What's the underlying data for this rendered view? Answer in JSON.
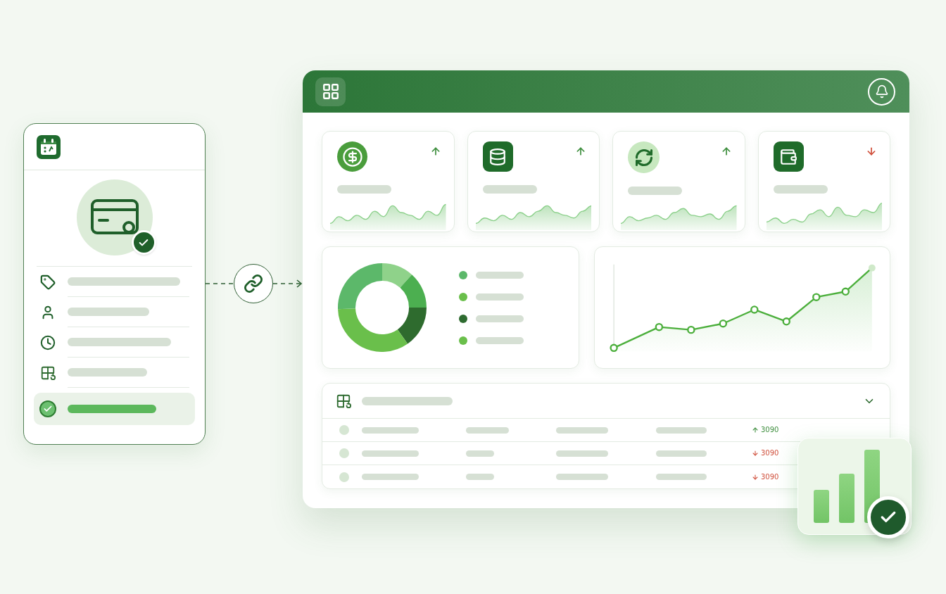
{
  "side_panel": {
    "items": [
      {
        "selected": false
      },
      {
        "selected": false
      },
      {
        "selected": false
      },
      {
        "selected": false
      },
      {
        "selected": true
      }
    ]
  },
  "dashboard": {
    "kpi_cards": [
      {
        "rising": true
      },
      {
        "rising": true
      },
      {
        "rising": true
      },
      {
        "rising": false
      }
    ],
    "donut_legend": [
      {
        "color": "#5cb86a"
      },
      {
        "color": "#6abf4b"
      },
      {
        "color": "#2e6b30"
      },
      {
        "color": "#6abf4b"
      }
    ],
    "table": {
      "expanded": true,
      "rows": [
        {
          "rising": true,
          "value": "3090"
        },
        {
          "rising": false,
          "value": "3090"
        },
        {
          "rising": false,
          "value": "3090"
        }
      ]
    }
  }
}
